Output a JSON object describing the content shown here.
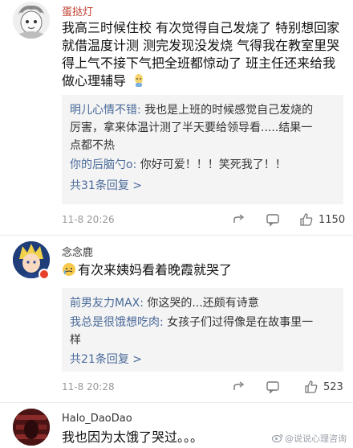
{
  "comments": [
    {
      "username": "蛋挞灯",
      "lines": [
        "我高三时候住校 有次觉得自己发烧了 特别想回家",
        "就借温度计测 测完发现没发烧 气得我在教室里哭",
        "得上气不接下气把全班都惊动了 班主任还来给我",
        "做心理辅导"
      ],
      "replies": [
        {
          "author": "明儿心情不错:",
          "lines": [
            " 我也是上班的时候感觉自己发烧的",
            "厉害，拿来体温计测了半天要给领导看.....结果一",
            "点都不热"
          ]
        },
        {
          "author": "你的后脑勺o:",
          "lines": [
            " 你好可爱！！！笑死我了！！"
          ]
        }
      ],
      "more_replies": "共31条回复 >",
      "time": "11-8 20:26",
      "likes": "1150"
    },
    {
      "username": "念念鹿",
      "lines": [
        "有次来姨妈看着晚霞就哭了"
      ],
      "replies": [
        {
          "author": "前男友力MAX:",
          "lines": [
            " 你这哭的...还颇有诗意"
          ]
        },
        {
          "author": "我总是很饿想吃肉:",
          "lines": [
            " 女孩子们过得像是在故事里一",
            "样"
          ]
        }
      ],
      "more_replies": "共21条回复 >",
      "time": "11-8 20:28",
      "likes": "523"
    },
    {
      "username": "Halo_DaoDao",
      "lines": [
        "我也因为太饿了哭过。。。"
      ]
    }
  ],
  "watermark": "@说说心理咨询"
}
